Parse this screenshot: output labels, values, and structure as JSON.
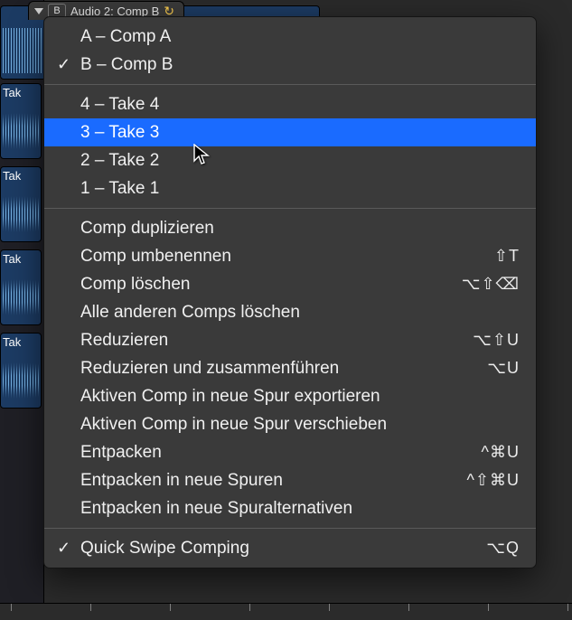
{
  "region_header": {
    "button_letter": "B",
    "title": "Audio 2: Comp B",
    "loop_glyph": "↻"
  },
  "side_regions": [
    {
      "label": "Tak"
    },
    {
      "label": "Tak"
    },
    {
      "label": "Tak"
    },
    {
      "label": "Tak"
    }
  ],
  "menu": {
    "comps": [
      {
        "label": "A – Comp A",
        "checked": false
      },
      {
        "label": "B – Comp B",
        "checked": true
      }
    ],
    "takes": [
      {
        "label": "4 – Take 4",
        "highlighted": false
      },
      {
        "label": "3 – Take 3",
        "highlighted": true
      },
      {
        "label": "2 – Take 2",
        "highlighted": false
      },
      {
        "label": "1 – Take 1",
        "highlighted": false
      }
    ],
    "actions": [
      {
        "label": "Comp duplizieren",
        "shortcut": ""
      },
      {
        "label": "Comp umbenennen",
        "shortcut": "⇧T"
      },
      {
        "label": "Comp löschen",
        "shortcut": "⌥⇧⌫"
      },
      {
        "label": "Alle anderen Comps löschen",
        "shortcut": ""
      },
      {
        "label": "Reduzieren",
        "shortcut": "⌥⇧U"
      },
      {
        "label": "Reduzieren und zusammenführen",
        "shortcut": "⌥U"
      },
      {
        "label": "Aktiven Comp in neue Spur exportieren",
        "shortcut": ""
      },
      {
        "label": "Aktiven Comp in neue Spur verschieben",
        "shortcut": ""
      },
      {
        "label": "Entpacken",
        "shortcut": "^⌘U"
      },
      {
        "label": "Entpacken in neue Spuren",
        "shortcut": "^⇧⌘U"
      },
      {
        "label": "Entpacken in neue Spuralternativen",
        "shortcut": ""
      }
    ],
    "footer": [
      {
        "label": "Quick Swipe Comping",
        "shortcut": "⌥Q",
        "checked": true
      }
    ]
  }
}
